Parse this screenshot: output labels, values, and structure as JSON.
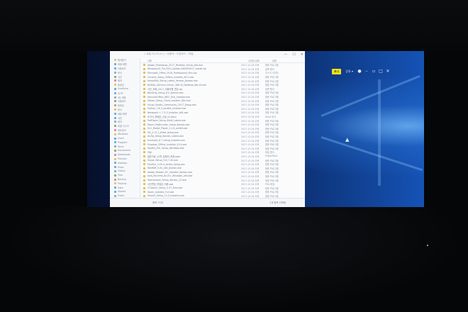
{
  "overlay": {
    "badge": "표시",
    "select": "공유 ▾",
    "icons": [
      "person-icon",
      "minimize-icon",
      "restore-icon",
      "maximize-icon",
      "close-icon"
    ]
  },
  "window": {
    "title_path": "« 로컬 디스크 (C:) › 사용자 › 다운로드 › 파일",
    "controls": [
      "—",
      "☐",
      "✕"
    ],
    "columns": {
      "name": "이름",
      "date": "수정한 날짜",
      "type": "유형"
    },
    "nav_items": [
      "즐겨찾기",
      "바탕 화면",
      "다운로드",
      "문서",
      "사진",
      "음악",
      "동영상",
      "OneDrive",
      "내 PC",
      "3D 개체",
      "다운로드",
      "동영상",
      "문서",
      "바탕 화면",
      "사진",
      "음악",
      "로컬 디스크",
      "네트워크",
      "Windows",
      "Users",
      "Program",
      "Temp",
      "Documents",
      "Downloads",
      "Pictures",
      "Desktop",
      "Music",
      "Videos",
      "Files",
      "Backup",
      "Projects",
      "Data",
      "Shared",
      "Public"
    ],
    "rows": [
      {
        "name": "Adobe_Photoshop_2017_Portable_Setup_x64.exe",
        "date": "2017-12-04 오후",
        "type": "응용 프로그램"
      },
      {
        "name": "Windows10_Pro_RS3_Update_KB4054517_Install.zip",
        "date": "2017-12-04 오후",
        "type": "압축 폴더"
      },
      {
        "name": "Microsoft_Office_2016_Professional_Plus.iso",
        "date": "2017-12-04 오후",
        "type": "디스크 이미지"
      },
      {
        "name": "Chrome_Setup_Offline_Installer_63.0.exe",
        "date": "2017-12-04 오후",
        "type": "응용 프로그램"
      },
      {
        "name": "KakaoTalk_Setup_Latest_Version_Korean.exe",
        "date": "2017-12-04 오후",
        "type": "응용 프로그램"
      },
      {
        "name": "NVIDIA_GeForce_Driver_388.43_Desktop_Win10.exe",
        "date": "2017-12-04 오후",
        "type": "응용 프로그램"
      },
      {
        "name": "사진_모음_2017_겨울여행_원본.zip",
        "date": "2017-12-04 오후",
        "type": "압축 폴더"
      },
      {
        "name": "Bandizip_Setup_6.0_Korean.exe",
        "date": "2017-12-04 오후",
        "type": "응용 프로그램"
      },
      {
        "name": "HancomOffice_NEO_Trial_Installer.exe",
        "date": "2017-12-04 오후",
        "type": "응용 프로그램"
      },
      {
        "name": "Steam_Setup_Client_Installer_Win.exe",
        "date": "2017-12-04 오후",
        "type": "응용 프로그램"
      },
      {
        "name": "Visual_Studio_Community_2017_Setup.exe",
        "date": "2017-12-04 오후",
        "type": "응용 프로그램"
      },
      {
        "name": "Python_3.6.3_amd64_Installer.exe",
        "date": "2017-12-04 오후",
        "type": "응용 프로그램"
      },
      {
        "name": "Notepad++_7.5.3_Installer_x64.exe",
        "date": "2017-12-04 오후",
        "type": "응용 프로그램"
      },
      {
        "name": "보고서_최종본_수정_v3.docx",
        "date": "2017-12-04 오후",
        "type": "Word 문서"
      },
      {
        "name": "PotPlayer_Setup_64bit_Latest.exe",
        "date": "2017-12-04 오후",
        "type": "응용 프로그램"
      },
      {
        "name": "Daum_PotEncoder_Setup_Korean.exe",
        "date": "2017-12-04 오후",
        "type": "응용 프로그램"
      },
      {
        "name": "VLC_Media_Player_2.2.6_win64.exe",
        "date": "2017-12-04 오후",
        "type": "응용 프로그램"
      },
      {
        "name": "Git_2.15.1_64bit_Setup.exe",
        "date": "2017-12-04 오후",
        "type": "응용 프로그램"
      },
      {
        "name": "ALZip_Setup_Korean_Latest.exe",
        "date": "2017-12-04 오후",
        "type": "응용 프로그램"
      },
      {
        "name": "Evernote_6.7_Setup_Installer.exe",
        "date": "2017-12-04 오후",
        "type": "응용 프로그램"
      },
      {
        "name": "Dropbox_Offline_Installer_40.4.exe",
        "date": "2017-12-04 오후",
        "type": "응용 프로그램"
      },
      {
        "name": "Spotify_Full_Setup_Windows.exe",
        "date": "2017-12-04 오후",
        "type": "응용 프로그램"
      },
      {
        "name": "자료",
        "date": "2017-12-04 오후",
        "type": "파일 폴더"
      },
      {
        "name": "발표자료_12월_팀회의_최종.pptx",
        "date": "2017-12-04 오후",
        "type": "PowerPoint"
      },
      {
        "name": "Skype_Setup_Full_7.40.exe",
        "date": "2017-12-04 오후",
        "type": "응용 프로그램"
      },
      {
        "name": "FileZilla_3.29.0_win64_Setup.exe",
        "date": "2017-12-04 오후",
        "type": "응용 프로그램"
      },
      {
        "name": "WinRAR_5.50_x64_Korean.exe",
        "date": "2017-12-04 오후",
        "type": "응용 프로그램"
      },
      {
        "name": "Adobe_Reader_DC_Installer_Korean.exe",
        "date": "2017-12-04 오후",
        "type": "응용 프로그램"
      },
      {
        "name": "Java_Runtime_8u151_Windows_x64.exe",
        "date": "2017-12-04 오후",
        "type": "응용 프로그램"
      },
      {
        "name": "Teamviewer_Setup_Korean_13.exe",
        "date": "2017-12-04 오후",
        "type": "응용 프로그램"
      },
      {
        "name": "사진편집_작업본_최종.psd",
        "date": "2017-12-04 오후",
        "type": "PSD 파일"
      },
      {
        "name": "CCleaner_Setup_5.37_Free.exe",
        "date": "2017-12-04 오후",
        "type": "응용 프로그램"
      },
      {
        "name": "Zoom_Installer_Full.exe",
        "date": "2017-12-04 오후",
        "type": "응용 프로그램"
      },
      {
        "name": "ShareX_Setup_12.0_Installer.exe",
        "date": "2017-12-04 오후",
        "type": "응용 프로그램"
      },
      {
        "name": "문서",
        "date": "2017-12-04 오후",
        "type": "파일 폴더"
      }
    ],
    "status_left": "항목 70개",
    "status_right": "1개 항목 선택함"
  }
}
